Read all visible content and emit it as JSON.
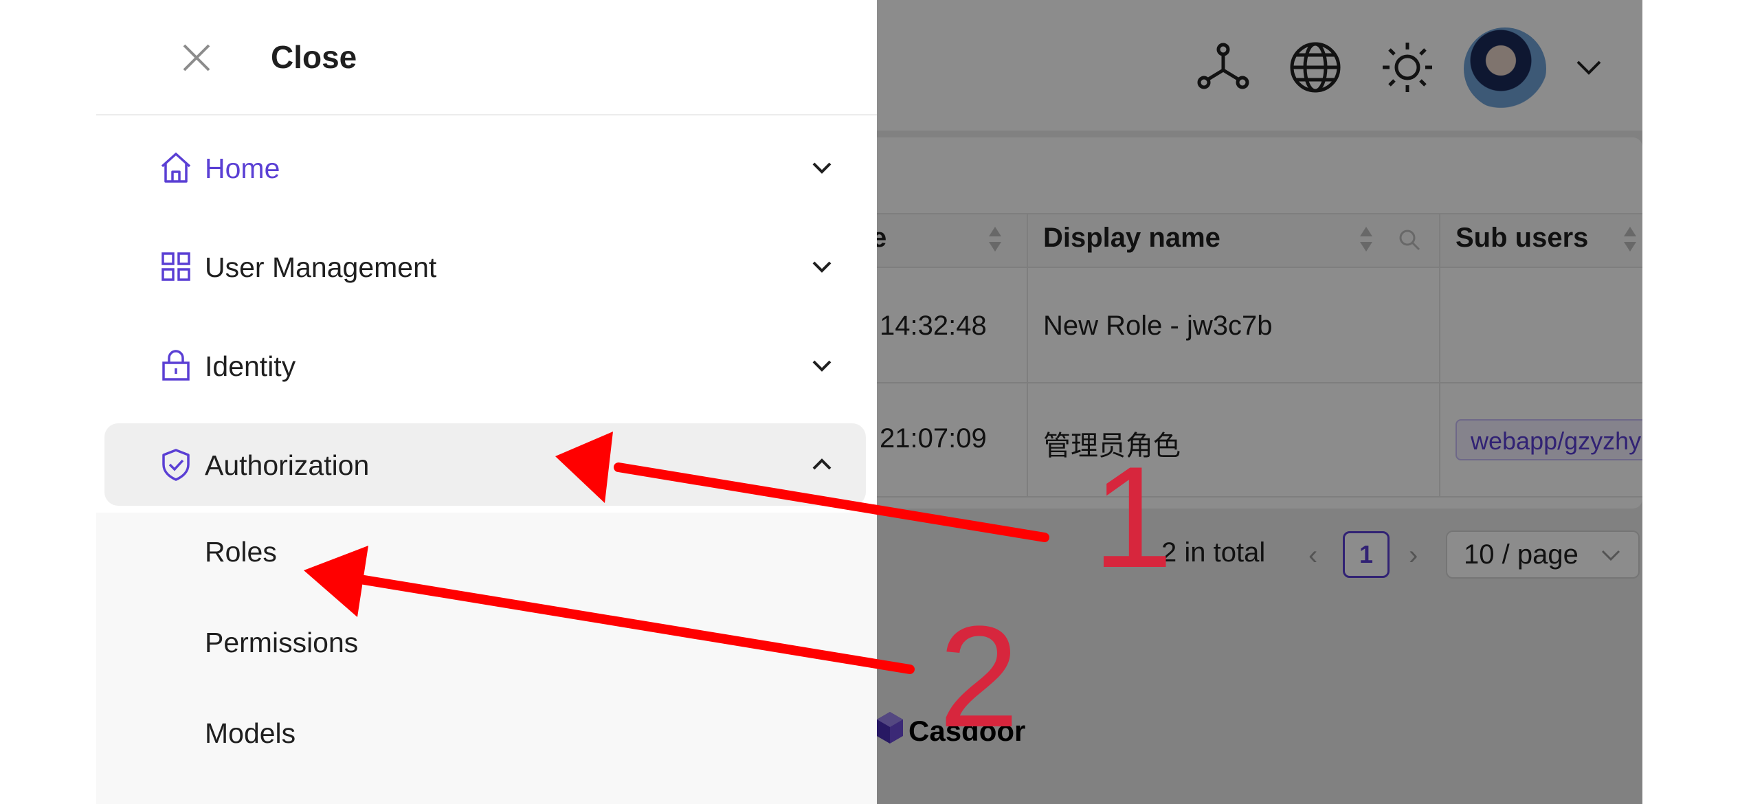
{
  "drawer": {
    "close_label": "Close",
    "menu": [
      {
        "label": "Home",
        "icon": "home-icon",
        "expanded": false
      },
      {
        "label": "User Management",
        "icon": "grid-icon",
        "expanded": false
      },
      {
        "label": "Identity",
        "icon": "lock-icon",
        "expanded": false
      },
      {
        "label": "Authorization",
        "icon": "shield-check-icon",
        "expanded": true
      }
    ],
    "submenu": [
      {
        "label": "Roles"
      },
      {
        "label": "Permissions"
      },
      {
        "label": "Models"
      }
    ]
  },
  "header": {
    "icons": [
      "network-icon",
      "globe-icon",
      "sun-icon",
      "avatar",
      "chevron-down-icon"
    ]
  },
  "table": {
    "columns": [
      "e",
      "Display name",
      "Sub users"
    ],
    "rows": [
      {
        "created": "14:32:48",
        "display_name": "New Role - jw3c7b",
        "sub_users": ""
      },
      {
        "created": "21:07:09",
        "display_name": "管理员角色",
        "sub_users": "webapp/gzyzhy"
      }
    ]
  },
  "pagination": {
    "total": "2 in total",
    "current_page": "1",
    "page_size": "10 / page"
  },
  "footer": {
    "brand": "Casdoor"
  },
  "annotations": {
    "label_1": "1",
    "label_2": "2",
    "arrow_color": "#ff0000",
    "number_color": "#d7263d"
  },
  "colors": {
    "accent": "#5a3fd4",
    "active_bg": "#efefef"
  }
}
